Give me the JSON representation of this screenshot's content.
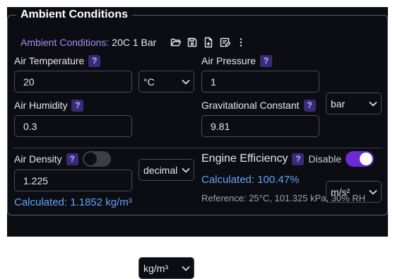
{
  "section_title": "Ambient Conditions",
  "toolbar": {
    "label": "Ambient Conditions:",
    "value": "20C 1 Bar",
    "icons": [
      "folder-open-icon",
      "save-icon",
      "new-file-icon",
      "edit-note-icon",
      "more-vertical-icon"
    ]
  },
  "help_glyph": "?",
  "fields": {
    "air_temperature": {
      "label": "Air Temperature",
      "value": "20",
      "unit": "°C"
    },
    "air_pressure": {
      "label": "Air Pressure",
      "value": "1",
      "unit": "bar"
    },
    "air_humidity": {
      "label": "Air Humidity",
      "value": "0.3",
      "unit": "decimal"
    },
    "gravitational_constant": {
      "label": "Gravitational Constant",
      "value": "9.81",
      "unit": "m/s²"
    }
  },
  "air_density": {
    "label": "Air Density",
    "toggle_on": false,
    "value": "1.225",
    "unit": "kg/m³",
    "calculated": "Calculated: 1.1852 kg/m³"
  },
  "engine_efficiency": {
    "label": "Engine Efficiency",
    "toggle_label": "Disable",
    "toggle_on": true,
    "calculated": "Calculated: 100.47%",
    "reference": "Reference: 25°C, 101.325 kPa, 30% RH"
  },
  "colors": {
    "panel_bg": "#0c0d12",
    "accent_purple": "#6d28d9",
    "label_purple": "#a78bfa",
    "calc_blue": "#60a5fa"
  }
}
